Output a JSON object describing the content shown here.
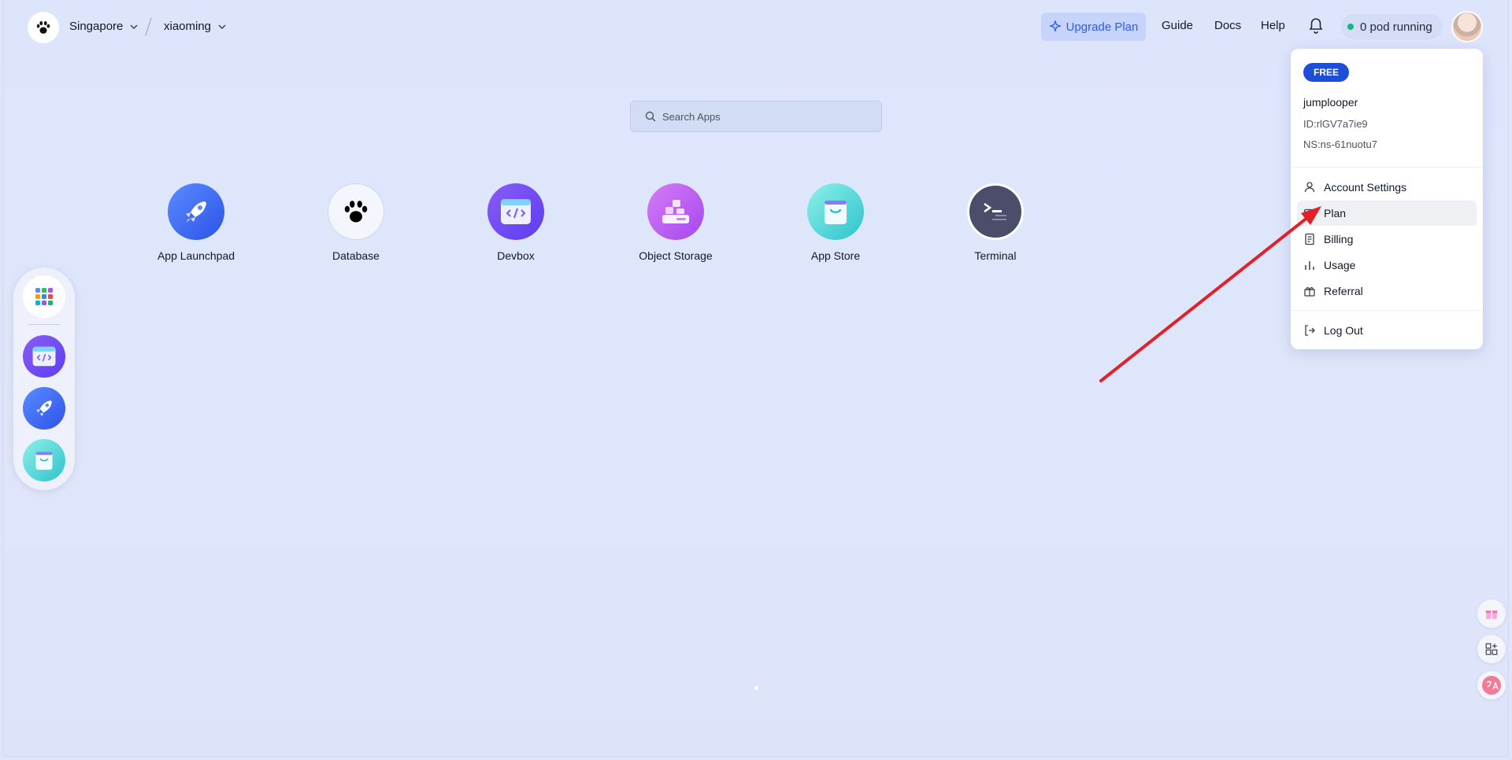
{
  "header": {
    "region": "Singapore",
    "workspace": "xiaoming",
    "upgrade_label": "Upgrade Plan",
    "guide": "Guide",
    "docs": "Docs",
    "help": "Help",
    "pod_status": "0 pod running"
  },
  "search": {
    "placeholder": "Search Apps"
  },
  "apps": [
    {
      "label": "App Launchpad",
      "icon": "rocket-icon"
    },
    {
      "label": "Database",
      "icon": "paw-icon"
    },
    {
      "label": "Devbox",
      "icon": "code-box-icon"
    },
    {
      "label": "Object Storage",
      "icon": "storage-blocks-icon"
    },
    {
      "label": "App Store",
      "icon": "shopping-bag-icon"
    },
    {
      "label": "Terminal",
      "icon": "terminal-icon"
    }
  ],
  "dock": [
    "grid-icon",
    "code-box-icon",
    "rocket-icon",
    "shopping-bag-icon"
  ],
  "account_menu": {
    "plan_badge": "FREE",
    "username": "jumplooper",
    "id": "ID:rlGV7a7ie9",
    "ns": "NS:ns-61nuotu7",
    "items": [
      {
        "label": "Account Settings",
        "icon": "user-icon"
      },
      {
        "label": "Plan",
        "icon": "card-icon"
      },
      {
        "label": "Billing",
        "icon": "receipt-icon"
      },
      {
        "label": "Usage",
        "icon": "bar-chart-icon"
      },
      {
        "label": "Referral",
        "icon": "gift-icon"
      }
    ],
    "logout": "Log Out"
  },
  "colors": {
    "accent": "#2f5bea",
    "badge": "#1d4ed8",
    "arrow": "#e3202a",
    "status_dot": "#10b981"
  }
}
